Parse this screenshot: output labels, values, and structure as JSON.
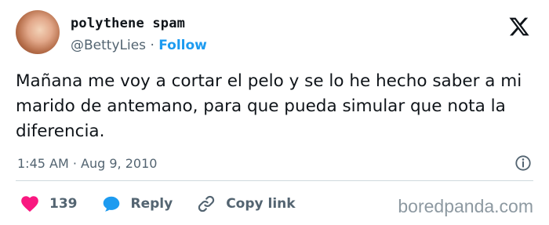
{
  "author": {
    "display_name": "polythene spam",
    "handle": "@BettyLies",
    "separator": "·",
    "follow_label": "Follow"
  },
  "tweet": {
    "text": "Mañana me voy a cortar el pelo y se lo he hecho saber a mi marido de antemano, para que pueda simular que nota la diferencia.",
    "time": "1:45 AM",
    "separator": "·",
    "date": "Aug 9, 2010"
  },
  "actions": {
    "like_count": "139",
    "reply_label": "Reply",
    "copy_link_label": "Copy link"
  },
  "watermark": "boredpanda.com",
  "icons": {
    "logo": "x-logo-icon",
    "info": "info-icon",
    "like": "heart-icon",
    "reply": "reply-bubble-icon",
    "copy": "link-icon"
  },
  "colors": {
    "text": "#0f1419",
    "secondary": "#536471",
    "follow": "#1d9bf0",
    "heart": "#f91880",
    "reply": "#1d9bf0",
    "divider": "#cfd9de",
    "watermark": "#8d99a1"
  }
}
